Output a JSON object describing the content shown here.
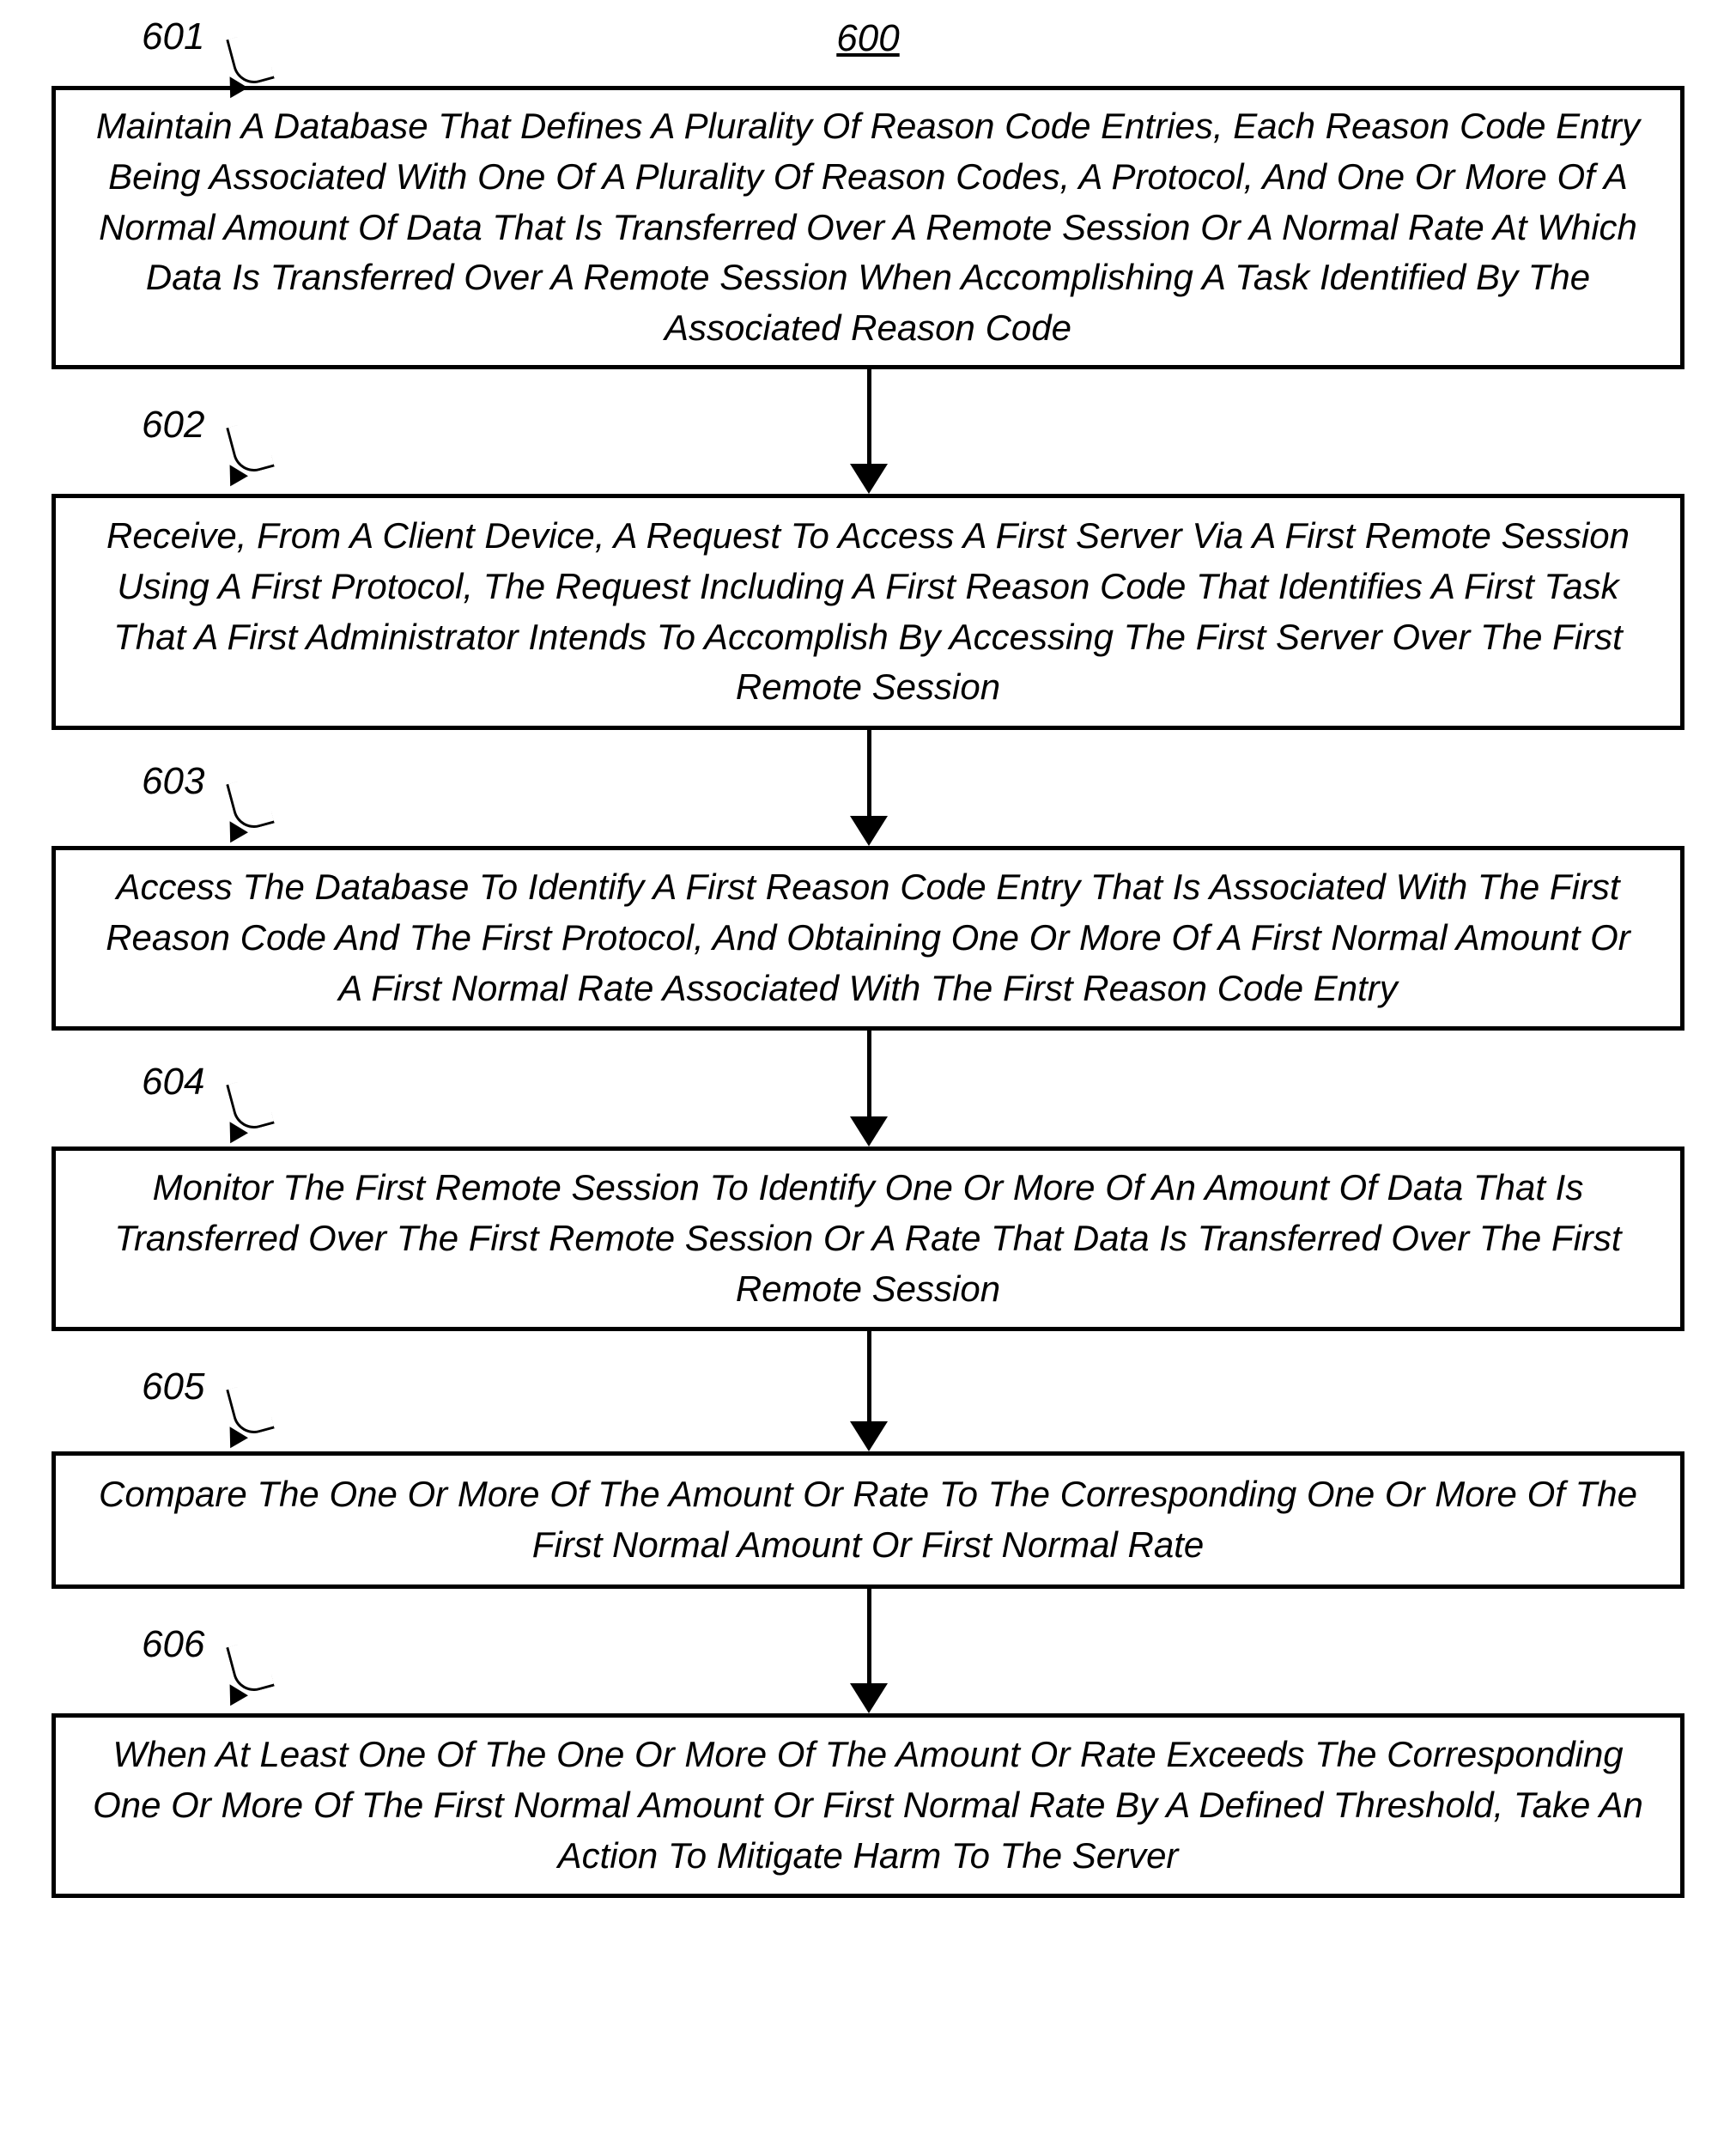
{
  "figure_number": "600",
  "steps": [
    {
      "number": "601",
      "text": "Maintain A Database That Defines A Plurality Of Reason Code Entries, Each Reason Code Entry Being Associated With One Of A Plurality Of Reason Codes, A Protocol, And One Or More Of A Normal Amount Of Data That Is Transferred Over A Remote Session Or A Normal Rate At Which Data Is Transferred Over A Remote Session When Accomplishing A Task Identified By The Associated Reason Code"
    },
    {
      "number": "602",
      "text": "Receive, From A Client Device, A Request To Access A First Server Via A First Remote Session Using A First Protocol, The Request Including A First Reason Code That Identifies A First Task That A First Administrator Intends To Accomplish By Accessing The First Server Over The First Remote Session"
    },
    {
      "number": "603",
      "text": "Access The Database To Identify A First Reason Code Entry That Is Associated With The First Reason Code And The First Protocol, And Obtaining One Or More Of A First Normal Amount Or A First Normal Rate Associated With The First Reason Code Entry"
    },
    {
      "number": "604",
      "text": "Monitor The First Remote Session To Identify One Or More Of An Amount Of Data That Is Transferred Over The First Remote Session Or A Rate That Data Is Transferred Over The First Remote Session"
    },
    {
      "number": "605",
      "text": "Compare The One Or More Of The Amount Or Rate To The Corresponding One Or More Of The First Normal Amount Or First Normal Rate"
    },
    {
      "number": "606",
      "text": "When At Least One Of The One Or More Of The Amount Or Rate Exceeds The Corresponding One Or More Of The First Normal Amount Or First Normal Rate By A Defined Threshold, Take An Action To Mitigate Harm To The Server"
    }
  ]
}
